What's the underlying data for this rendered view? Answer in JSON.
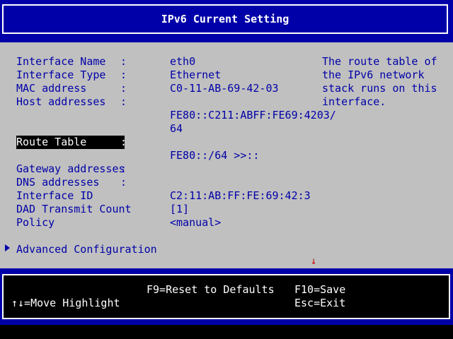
{
  "title": "IPv6 Current Setting",
  "fields": [
    {
      "label": "Interface Name",
      "value": "eth0"
    },
    {
      "label": "Interface Type",
      "value": "Ethernet"
    },
    {
      "label": "MAC address",
      "value": "C0-11-AB-69-42-03"
    },
    {
      "label": "Host addresses",
      "value": ""
    },
    {
      "label": "",
      "value": "FE80::C211:ABFF:FE69:4203/"
    },
    {
      "label": "",
      "value": "64"
    },
    {
      "label": "Route Table",
      "value": ""
    },
    {
      "label": "",
      "value": "FE80::/64 >>::"
    },
    {
      "label": "Gateway addresses",
      "value": ""
    },
    {
      "label": "DNS addresses",
      "value": ""
    },
    {
      "label": "Interface ID",
      "value": "C2:11:AB:FF:FE:69:42:3"
    },
    {
      "label": "DAD Transmit Count",
      "value": "[1]"
    },
    {
      "label": "Policy",
      "value": "<manual>"
    }
  ],
  "colon": ":",
  "advanced_label": "Advanced Configuration",
  "help_text": "The route table of\nthe IPv6 network\nstack runs on this\ninterface.",
  "footer": {
    "reset_defaults": "F9=Reset to Defaults",
    "save": "F10=Save",
    "move_highlight": "↑↓=Move Highlight",
    "exit": "Esc=Exit"
  },
  "icons": {
    "advanced": "triangle-right-icon",
    "scroll": "arrow-down-icon"
  },
  "colors": {
    "background": "#0000a8",
    "panel": "#c0c0c0",
    "text": "#0000a8",
    "highlight_bg": "#000000",
    "highlight_fg": "#ffffff",
    "scroll_arrow": "#cc0000"
  }
}
